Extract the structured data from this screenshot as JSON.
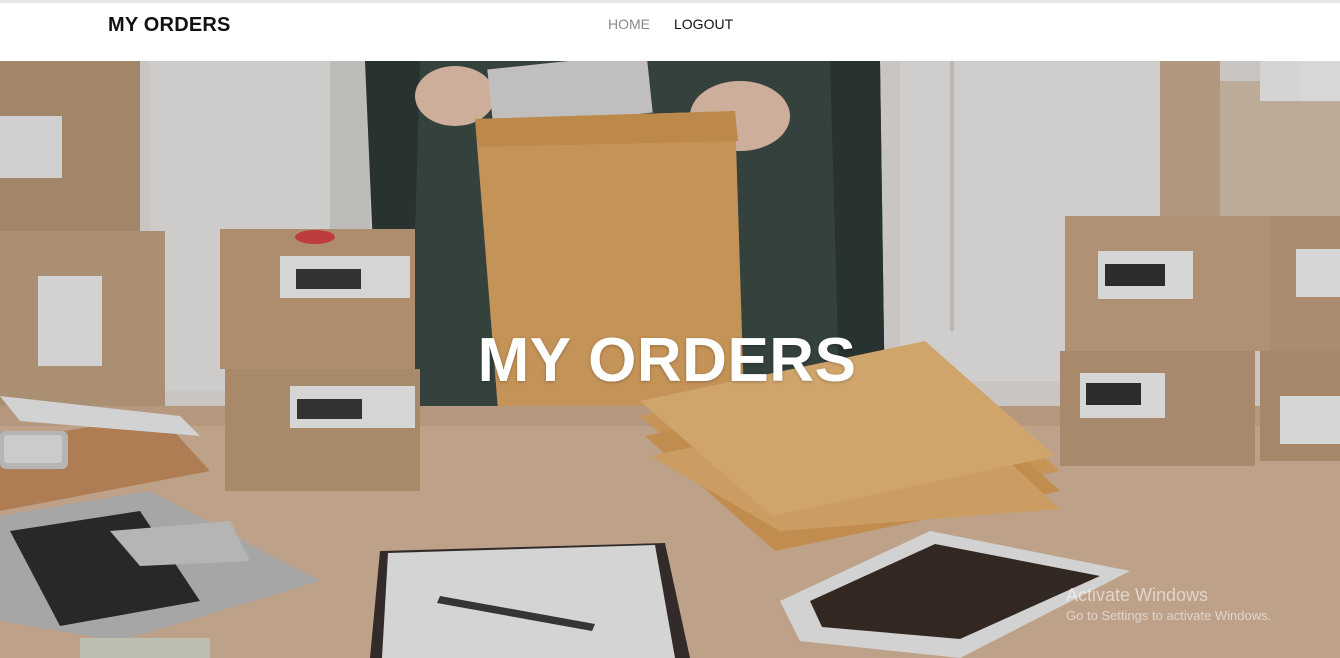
{
  "navbar": {
    "brand": "MY ORDERS",
    "links": [
      {
        "label": "HOME"
      },
      {
        "label": "LOGOUT"
      }
    ]
  },
  "hero": {
    "title": "MY ORDERS"
  },
  "watermark": {
    "title": "Activate Windows",
    "subtitle": "Go to Settings to activate Windows."
  },
  "colors": {
    "brand_text": "#111111",
    "nav_home": "#8a8a8a",
    "nav_logout": "#111111",
    "hero_title": "#ffffff"
  }
}
